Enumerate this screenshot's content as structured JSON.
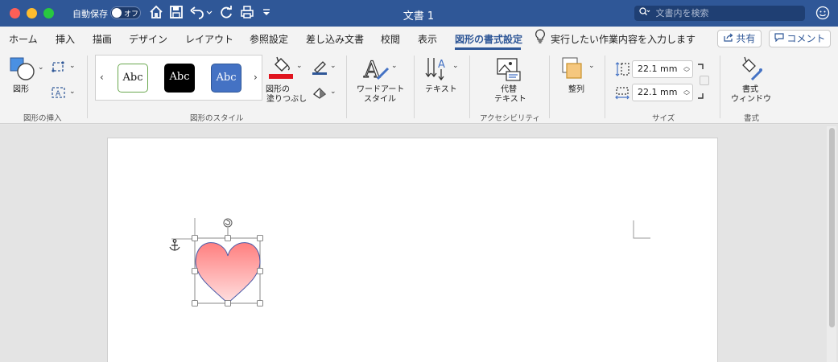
{
  "titlebar": {
    "autosave_label": "自動保存",
    "autosave_state": "オフ",
    "doc_title": "文書 1",
    "search_placeholder": "文書内を検索",
    "icons": [
      "home-icon",
      "save-icon",
      "undo-icon",
      "redo-icon",
      "print-icon",
      "customize-toolbar-icon",
      "user-icon"
    ]
  },
  "tabs": [
    {
      "label": "ホーム"
    },
    {
      "label": "挿入"
    },
    {
      "label": "描画"
    },
    {
      "label": "デザイン"
    },
    {
      "label": "レイアウト"
    },
    {
      "label": "参照設定"
    },
    {
      "label": "差し込み文書"
    },
    {
      "label": "校閲"
    },
    {
      "label": "表示"
    },
    {
      "label": "図形の書式設定",
      "active": true
    }
  ],
  "tell_me": "実行したい作業内容を入力します",
  "share_label": "共有",
  "comment_label": "コメント",
  "ribbon": {
    "insert_shapes": {
      "shapes_label": "図形",
      "group_label": "図形の挿入"
    },
    "shape_styles": {
      "style_samples": [
        "Abc",
        "Abc",
        "Abc"
      ],
      "fill_label_1": "図形の",
      "fill_label_2": "塗りつぶし",
      "group_label": "図形のスタイル",
      "fill_color": "#e0141e"
    },
    "wordart": {
      "label_1": "ワードアート",
      "label_2": "スタイル"
    },
    "text": {
      "label": "テキスト"
    },
    "accessibility": {
      "alt_label_1": "代替",
      "alt_label_2": "テキスト",
      "group_label": "アクセシビリティ"
    },
    "arrange": {
      "label": "整列"
    },
    "size": {
      "height": "22.1 mm",
      "width": "22.1 mm",
      "group_label": "サイズ"
    },
    "format": {
      "label_1": "書式",
      "label_2": "ウィンドウ",
      "group_label": "書式"
    }
  },
  "colors": {
    "accent": "#2f5797",
    "heart_top": "#ff7f7f",
    "heart_bottom": "#ffe1e1",
    "heart_stroke": "#4a5aa8"
  }
}
